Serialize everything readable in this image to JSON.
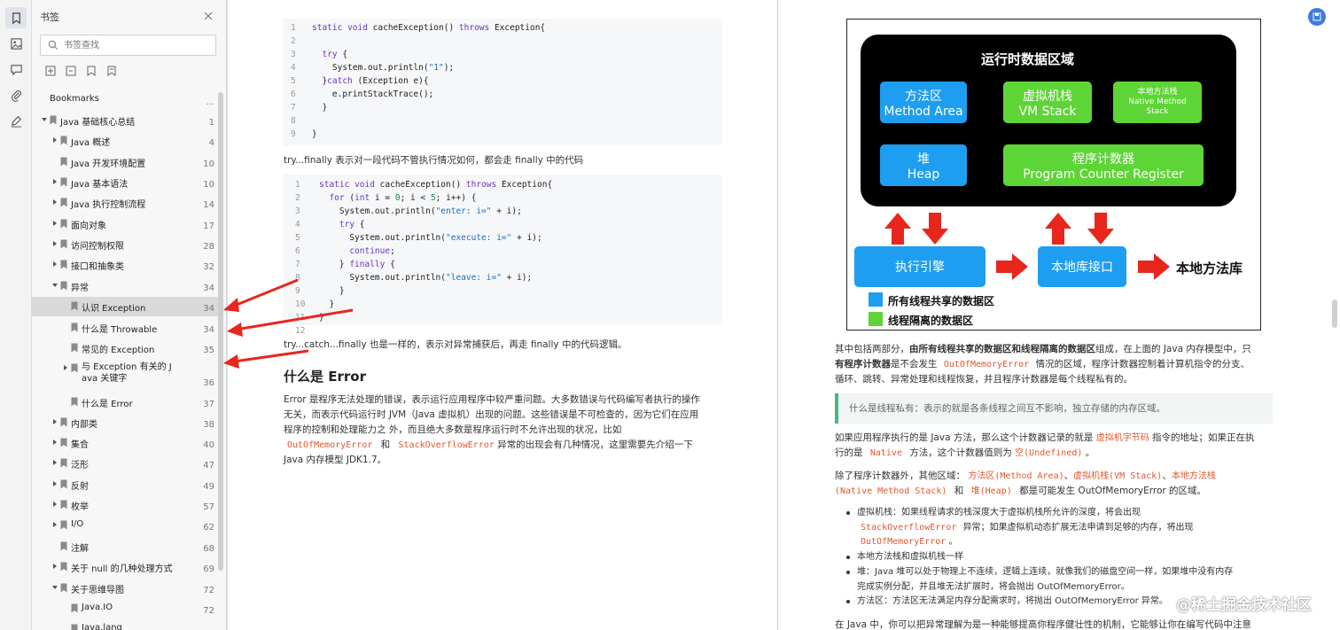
{
  "panel": {
    "title": "书签",
    "search_placeholder": "书签查找"
  },
  "tree": [
    {
      "label": "Bookmarks",
      "page": "...",
      "level": 0,
      "toggle": false,
      "icon": false
    },
    {
      "label": "Java 基础核心总结",
      "page": "1",
      "level": 0,
      "toggle": true,
      "icon": true
    },
    {
      "label": "Java 概述",
      "page": "4",
      "level": 1,
      "toggle": true,
      "icon": true
    },
    {
      "label": "Java 开发环境配置",
      "page": "10",
      "level": 1,
      "toggle": false,
      "icon": true
    },
    {
      "label": "Java 基本语法",
      "page": "10",
      "level": 1,
      "toggle": true,
      "icon": true
    },
    {
      "label": "Java 执行控制流程",
      "page": "14",
      "level": 1,
      "toggle": true,
      "icon": true
    },
    {
      "label": "面向对象",
      "page": "17",
      "level": 1,
      "toggle": true,
      "icon": true
    },
    {
      "label": "访问控制权限",
      "page": "28",
      "level": 1,
      "toggle": true,
      "icon": true
    },
    {
      "label": "接口和抽象类",
      "page": "32",
      "level": 1,
      "toggle": true,
      "icon": true
    },
    {
      "label": "异常",
      "page": "34",
      "level": 1,
      "toggle": true,
      "icon": true
    },
    {
      "label": "认识 Exception",
      "page": "34",
      "level": 2,
      "toggle": false,
      "icon": true
    },
    {
      "label": "什么是 Throwable",
      "page": "34",
      "level": 2,
      "toggle": false,
      "icon": true
    },
    {
      "label": "常见的 Exception",
      "page": "35",
      "level": 2,
      "toggle": false,
      "icon": true
    },
    {
      "label": "与 Exception 有关的 J",
      "label2": "ava 关键字",
      "page": "36",
      "level": 2,
      "toggle": true,
      "icon": true
    },
    {
      "label": "什么是 Error",
      "page": "37",
      "level": 2,
      "toggle": false,
      "icon": true
    },
    {
      "label": "内部类",
      "page": "38",
      "level": 1,
      "toggle": true,
      "icon": true
    },
    {
      "label": "集合",
      "page": "40",
      "level": 1,
      "toggle": true,
      "icon": true
    },
    {
      "label": "泛形",
      "page": "47",
      "level": 1,
      "toggle": true,
      "icon": true
    },
    {
      "label": "反射",
      "page": "49",
      "level": 1,
      "toggle": true,
      "icon": true
    },
    {
      "label": "枚举",
      "page": "57",
      "level": 1,
      "toggle": true,
      "icon": true
    },
    {
      "label": "I/O",
      "page": "62",
      "level": 1,
      "toggle": true,
      "icon": true
    },
    {
      "label": "注解",
      "page": "68",
      "level": 1,
      "toggle": false,
      "icon": true
    },
    {
      "label": "关于 null 的几种处理方式",
      "page": "69",
      "level": 1,
      "toggle": true,
      "icon": true
    },
    {
      "label": "关于思维导图",
      "page": "72",
      "level": 1,
      "toggle": true,
      "icon": true
    },
    {
      "label": "Java.IO",
      "page": "72",
      "level": 2,
      "toggle": false,
      "icon": true
    },
    {
      "label": "Java.lang",
      "page": "",
      "level": 2,
      "toggle": false,
      "icon": true
    }
  ],
  "code1": {
    "lines": [
      "1",
      "2",
      "3",
      "4",
      "5",
      "6",
      "7",
      "8",
      "9"
    ],
    "code": [
      "static void cacheException() throws Exception{",
      "",
      "  try {",
      "    System.out.println(\"1\");",
      "  }catch (Exception e){",
      "    e.printStackTrace();",
      "  }",
      "",
      "}"
    ]
  },
  "para1": "try...finally 表示对一段代码不管执行情况如何，都会走 finally 中的代码",
  "code2": {
    "lines": [
      "1",
      "2",
      "3",
      "4",
      "5",
      "6",
      "7",
      "8",
      "9",
      "10",
      "11",
      "12"
    ],
    "code": [
      "static void cacheException() throws Exception{",
      "  for (int i = 0; i < 5; i++) {",
      "    System.out.println(\"enter: i=\" + i);",
      "    try {",
      "      System.out.println(\"execute: i=\" + i);",
      "      continue;",
      "    } finally {",
      "      System.out.println(\"leave: i=\" + i);",
      "    }",
      "  }",
      "}",
      ""
    ]
  },
  "para2": "try...catch...finally 也是一样的，表示对异常捕获后，再走 finally 中的代码逻辑。",
  "heading_error": "什么是 Error",
  "error_para": {
    "l1": "Error 是程序无法处理的错误，表示运行应用程序中较严重问题。大多数错误与代码编写者执行的操作",
    "l2": "无关，而表示代码运行时 JVM（Java 虚拟机）出现的问题。这些错误是不可检查的，因为它们在应用",
    "l3": "程序的控制和处理能力之 外，而且绝大多数是程序运行时不允许出现的状况，比如",
    "c1": "OutOfMemoryError",
    "and": "和",
    "c2": "StackOverflowError",
    "l4": "异常的出现会有几种情况，这里需要先介绍一下",
    "l5": "Java 内存模型 JDK1.7。"
  },
  "diagram": {
    "title": "运行时数据区域",
    "method_area_cn": "方法区",
    "method_area_en": "Method Area",
    "vm_stack_cn": "虚拟机栈",
    "vm_stack_en": "VM Stack",
    "native_stack_cn": "本地方法栈",
    "native_stack_en1": "Native Method",
    "native_stack_en2": "Stack",
    "heap_cn": "堆",
    "heap_en": "Heap",
    "pc_cn": "程序计数器",
    "pc_en": "Program Counter Register",
    "engine": "执行引擎",
    "native_interface": "本地库接口",
    "native_lib": "本地方法库",
    "legend_shared": "所有线程共享的数据区",
    "legend_isolated": "线程隔离的数据区",
    "colors": {
      "blue": "#1e9ef0",
      "green": "#5ed536",
      "arrow": "#e8261c"
    }
  },
  "right_para1": {
    "a": "其中包括两部分，",
    "b": "由所有线程共享的数据区和线程隔离的数据区",
    "c": "组成，在上面的 Java 内存模型中，只",
    "d": "有程序计数器",
    "e": "是不会发生",
    "code": "OutOfMemoryError",
    "f": "情况的区域，程序计数器控制着计算机指令的分支、",
    "l2": "循环、跳转、异常处理和线程恢复，并且程序计数器是每个线程私有的。"
  },
  "callout": "什么是线程私有：表示的就是各条线程之间互不影响，独立存储的内存区域。",
  "right_para2": {
    "a": "如果应用程序执行的是 Java 方法，那么这个计数器记录的就是",
    "c1": "虚拟机字节码",
    "b": "指令的地址；如果正在执",
    "c": "行的是",
    "c2": "Native",
    "d": "方法，这个计数器值则为",
    "c3": "空(Undefined)",
    "e": "。"
  },
  "right_para3": {
    "a": "除了程序计数器外，其他区域：",
    "c1": "方法区(Method Area)",
    "s1": "、",
    "c2": "虚拟机栈(VM Stack)",
    "s2": "、",
    "c3": "本地方法栈",
    "c4": "(Native Method Stack)",
    "and": "和",
    "c5": "堆(Heap)",
    "b": "都是可能发生 OutOfMemoryError 的区域。"
  },
  "bullets": {
    "b1a": "虚拟机栈：如果线程请求的栈深度大于虚拟机栈所允许的深度，将会出现",
    "b1c1": "StackOverflowError",
    "b1b": "异常；如果虚拟机动态扩展无法申请到足够的内存，将出现",
    "b1c2": "OutOfMemoryError",
    "b1d": "。",
    "b2": "本地方法栈和虚拟机栈一样",
    "b3a": "堆：Java 堆可以处于物理上不连续，逻辑上连续，就像我们的磁盘空间一样，如果堆中没有内存",
    "b3b": "完成实例分配，并且堆无法扩展时，将会抛出 OutOfMemoryError。",
    "b4": "方法区：方法区无法满足内存分配需求时，将抛出 OutOfMemoryError 异常。"
  },
  "bottom_line": "在 Java 中，你可以把异常理解为是一种能够提高你程序健壮性的机制，它能够让你在编写代码中注意",
  "watermark": "@稀土掘金技术社区"
}
